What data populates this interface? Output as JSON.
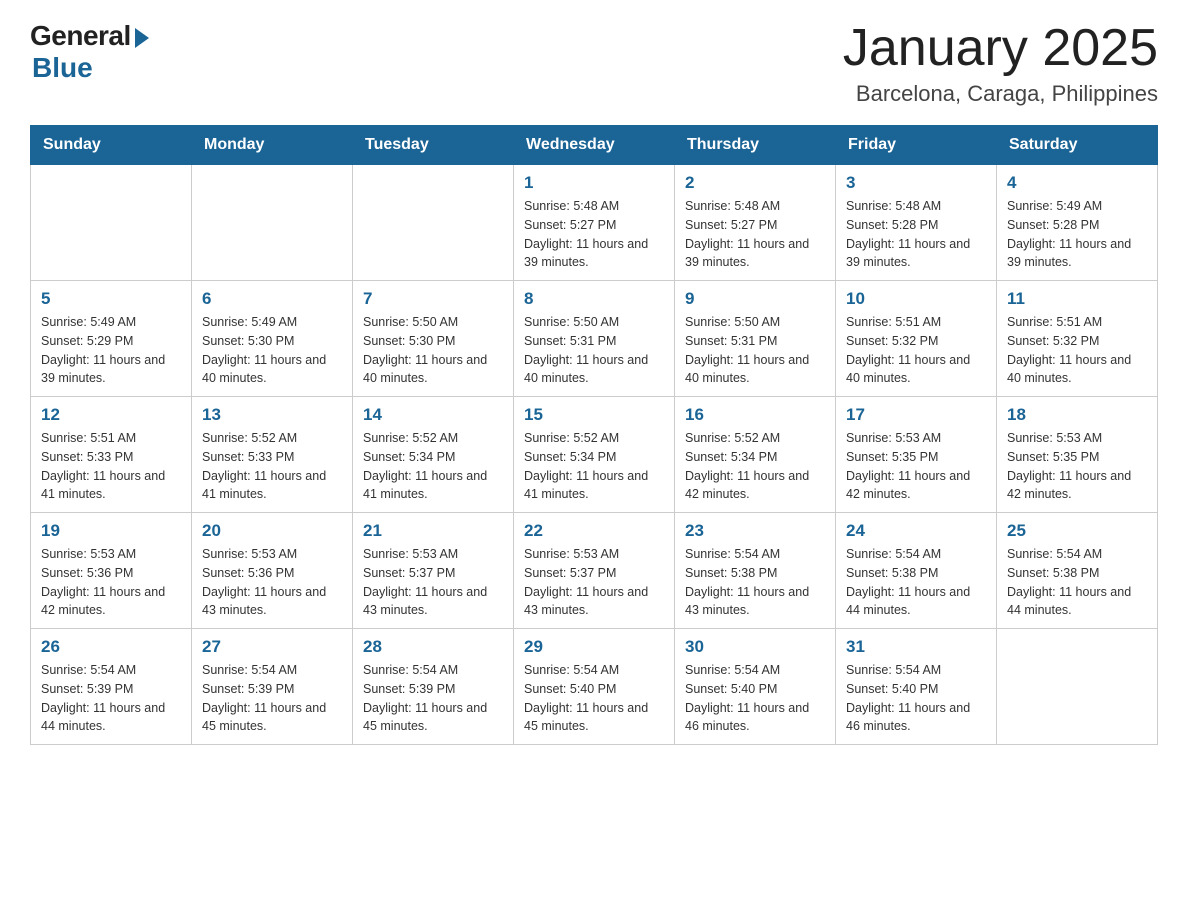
{
  "logo": {
    "general": "General",
    "blue": "Blue"
  },
  "title": "January 2025",
  "subtitle": "Barcelona, Caraga, Philippines",
  "weekdays": [
    "Sunday",
    "Monday",
    "Tuesday",
    "Wednesday",
    "Thursday",
    "Friday",
    "Saturday"
  ],
  "weeks": [
    [
      {
        "day": "",
        "info": ""
      },
      {
        "day": "",
        "info": ""
      },
      {
        "day": "",
        "info": ""
      },
      {
        "day": "1",
        "info": "Sunrise: 5:48 AM\nSunset: 5:27 PM\nDaylight: 11 hours and 39 minutes."
      },
      {
        "day": "2",
        "info": "Sunrise: 5:48 AM\nSunset: 5:27 PM\nDaylight: 11 hours and 39 minutes."
      },
      {
        "day": "3",
        "info": "Sunrise: 5:48 AM\nSunset: 5:28 PM\nDaylight: 11 hours and 39 minutes."
      },
      {
        "day": "4",
        "info": "Sunrise: 5:49 AM\nSunset: 5:28 PM\nDaylight: 11 hours and 39 minutes."
      }
    ],
    [
      {
        "day": "5",
        "info": "Sunrise: 5:49 AM\nSunset: 5:29 PM\nDaylight: 11 hours and 39 minutes."
      },
      {
        "day": "6",
        "info": "Sunrise: 5:49 AM\nSunset: 5:30 PM\nDaylight: 11 hours and 40 minutes."
      },
      {
        "day": "7",
        "info": "Sunrise: 5:50 AM\nSunset: 5:30 PM\nDaylight: 11 hours and 40 minutes."
      },
      {
        "day": "8",
        "info": "Sunrise: 5:50 AM\nSunset: 5:31 PM\nDaylight: 11 hours and 40 minutes."
      },
      {
        "day": "9",
        "info": "Sunrise: 5:50 AM\nSunset: 5:31 PM\nDaylight: 11 hours and 40 minutes."
      },
      {
        "day": "10",
        "info": "Sunrise: 5:51 AM\nSunset: 5:32 PM\nDaylight: 11 hours and 40 minutes."
      },
      {
        "day": "11",
        "info": "Sunrise: 5:51 AM\nSunset: 5:32 PM\nDaylight: 11 hours and 40 minutes."
      }
    ],
    [
      {
        "day": "12",
        "info": "Sunrise: 5:51 AM\nSunset: 5:33 PM\nDaylight: 11 hours and 41 minutes."
      },
      {
        "day": "13",
        "info": "Sunrise: 5:52 AM\nSunset: 5:33 PM\nDaylight: 11 hours and 41 minutes."
      },
      {
        "day": "14",
        "info": "Sunrise: 5:52 AM\nSunset: 5:34 PM\nDaylight: 11 hours and 41 minutes."
      },
      {
        "day": "15",
        "info": "Sunrise: 5:52 AM\nSunset: 5:34 PM\nDaylight: 11 hours and 41 minutes."
      },
      {
        "day": "16",
        "info": "Sunrise: 5:52 AM\nSunset: 5:34 PM\nDaylight: 11 hours and 42 minutes."
      },
      {
        "day": "17",
        "info": "Sunrise: 5:53 AM\nSunset: 5:35 PM\nDaylight: 11 hours and 42 minutes."
      },
      {
        "day": "18",
        "info": "Sunrise: 5:53 AM\nSunset: 5:35 PM\nDaylight: 11 hours and 42 minutes."
      }
    ],
    [
      {
        "day": "19",
        "info": "Sunrise: 5:53 AM\nSunset: 5:36 PM\nDaylight: 11 hours and 42 minutes."
      },
      {
        "day": "20",
        "info": "Sunrise: 5:53 AM\nSunset: 5:36 PM\nDaylight: 11 hours and 43 minutes."
      },
      {
        "day": "21",
        "info": "Sunrise: 5:53 AM\nSunset: 5:37 PM\nDaylight: 11 hours and 43 minutes."
      },
      {
        "day": "22",
        "info": "Sunrise: 5:53 AM\nSunset: 5:37 PM\nDaylight: 11 hours and 43 minutes."
      },
      {
        "day": "23",
        "info": "Sunrise: 5:54 AM\nSunset: 5:38 PM\nDaylight: 11 hours and 43 minutes."
      },
      {
        "day": "24",
        "info": "Sunrise: 5:54 AM\nSunset: 5:38 PM\nDaylight: 11 hours and 44 minutes."
      },
      {
        "day": "25",
        "info": "Sunrise: 5:54 AM\nSunset: 5:38 PM\nDaylight: 11 hours and 44 minutes."
      }
    ],
    [
      {
        "day": "26",
        "info": "Sunrise: 5:54 AM\nSunset: 5:39 PM\nDaylight: 11 hours and 44 minutes."
      },
      {
        "day": "27",
        "info": "Sunrise: 5:54 AM\nSunset: 5:39 PM\nDaylight: 11 hours and 45 minutes."
      },
      {
        "day": "28",
        "info": "Sunrise: 5:54 AM\nSunset: 5:39 PM\nDaylight: 11 hours and 45 minutes."
      },
      {
        "day": "29",
        "info": "Sunrise: 5:54 AM\nSunset: 5:40 PM\nDaylight: 11 hours and 45 minutes."
      },
      {
        "day": "30",
        "info": "Sunrise: 5:54 AM\nSunset: 5:40 PM\nDaylight: 11 hours and 46 minutes."
      },
      {
        "day": "31",
        "info": "Sunrise: 5:54 AM\nSunset: 5:40 PM\nDaylight: 11 hours and 46 minutes."
      },
      {
        "day": "",
        "info": ""
      }
    ]
  ]
}
